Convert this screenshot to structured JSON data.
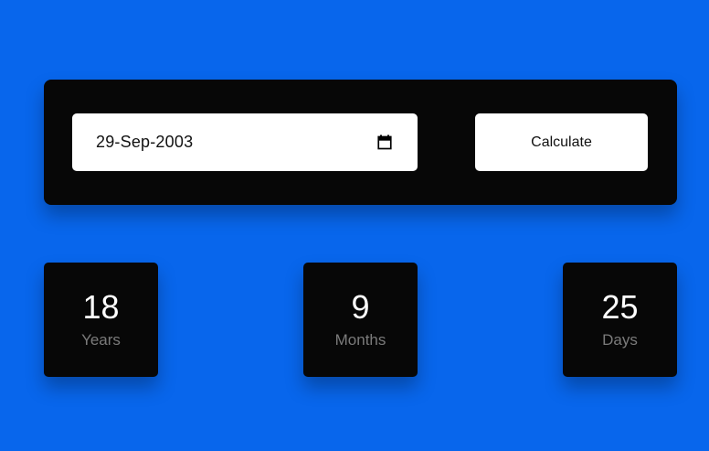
{
  "form": {
    "date_value": "29-Sep-2003",
    "calendar_icon": "calendar-icon",
    "calculate_label": "Calculate"
  },
  "results": {
    "years": {
      "value": "18",
      "label": "Years"
    },
    "months": {
      "value": "9",
      "label": "Months"
    },
    "days": {
      "value": "25",
      "label": "Days"
    }
  },
  "colors": {
    "background": "#0866ec",
    "panel": "#070707",
    "field": "#ffffff",
    "result_number": "#ffffff",
    "result_label": "#7b7b7b"
  }
}
